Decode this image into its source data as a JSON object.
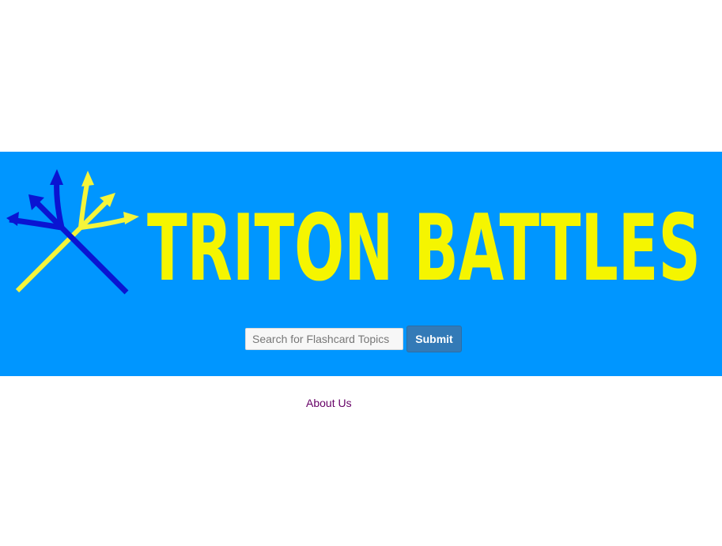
{
  "header": {
    "logo_icon": "crossed-tridents-icon",
    "logo_text": "TRITON BATTLES"
  },
  "search": {
    "placeholder": "Search for Flashcard Topics",
    "value": "",
    "submit_label": "Submit"
  },
  "footer": {
    "about_link": "About Us"
  },
  "colors": {
    "banner_background": "#0096ff",
    "logo_text": "#f5f500",
    "trident_yellow": "#f5f53a",
    "trident_blue": "#0a14d2",
    "button": "#337ab7",
    "link": "#660066"
  }
}
